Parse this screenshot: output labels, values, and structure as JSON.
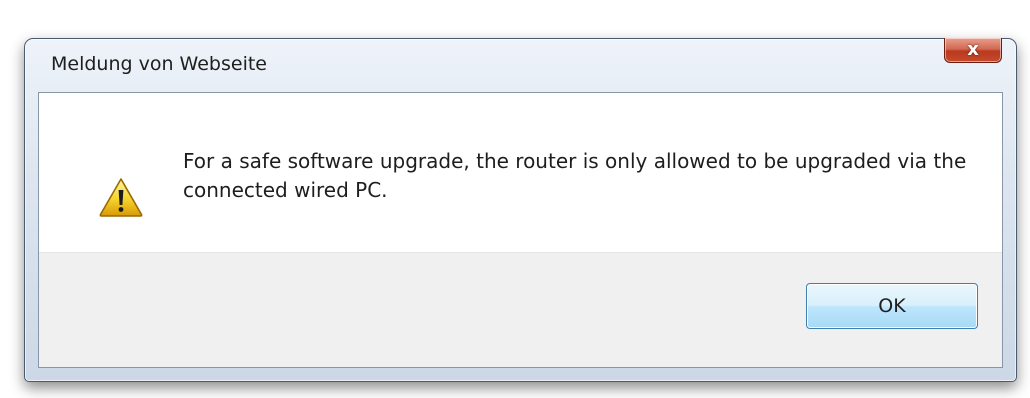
{
  "dialog": {
    "title": "Meldung von Webseite",
    "close_glyph": "x",
    "message": "For a safe software upgrade, the router is only allowed to be upgraded via the connected wired PC.",
    "icon": "warning-icon",
    "ok_label": "OK"
  },
  "colors": {
    "close_button": "#c8452a",
    "ok_button_border": "#3c7fb1",
    "button_bar": "#f0f0f0",
    "frame": "#d6e0eb"
  }
}
